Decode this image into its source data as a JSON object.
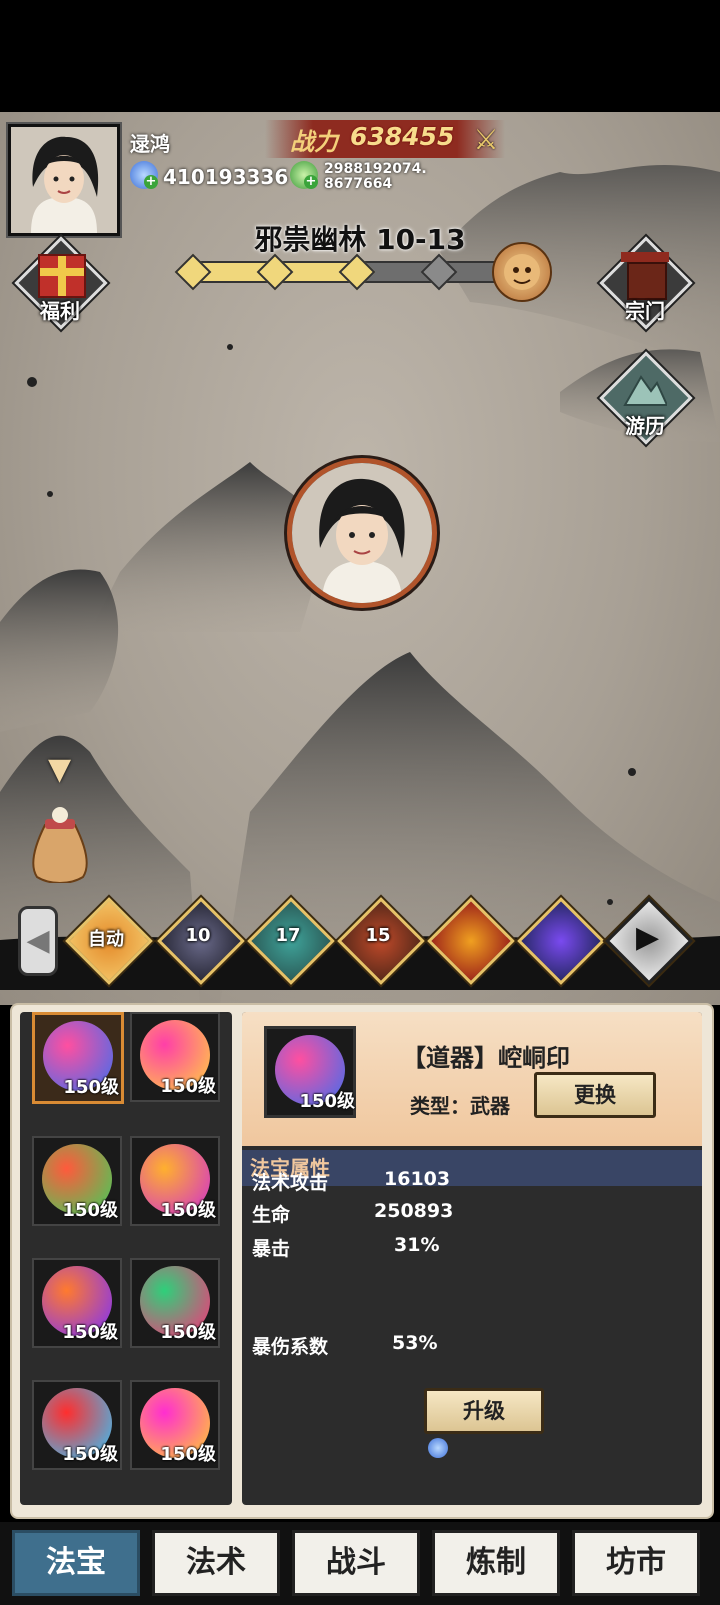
{
  "player": {
    "name": "逯鸿",
    "spirit_stones": "410193336",
    "jade": "2988192074.\n8677664",
    "power_label": "战力",
    "power_value": "638455"
  },
  "stage": {
    "title": "邪祟幽林 10-13",
    "progress_nodes_cleared": 3,
    "progress_nodes_total": 4
  },
  "side_buttons": {
    "welfare": "福利",
    "sect": "宗门",
    "travel": "游历"
  },
  "skills": [
    {
      "label": "自动",
      "icon": "auto-icon"
    },
    {
      "label": "10",
      "icon": "vortex-icon"
    },
    {
      "label": "17",
      "icon": "wind-icon"
    },
    {
      "label": "15",
      "icon": "flame-icon"
    },
    {
      "label": "",
      "icon": "fire-ring-icon"
    },
    {
      "label": "",
      "icon": "palm-icon"
    },
    {
      "label": "",
      "icon": "video-play-icon"
    }
  ],
  "treasures": [
    {
      "level": "150级",
      "icon": "seal-icon",
      "colors": [
        "#ff4fa0",
        "#3b6ef0"
      ]
    },
    {
      "level": "150级",
      "icon": "dagger-icon",
      "colors": [
        "#ff3fa8",
        "#ffd23f"
      ]
    },
    {
      "level": "150级",
      "icon": "armor-icon",
      "colors": [
        "#ff5a3c",
        "#3cd25a"
      ]
    },
    {
      "level": "150级",
      "icon": "boots-icon",
      "colors": [
        "#ffb02e",
        "#d02ed0"
      ]
    },
    {
      "level": "150级",
      "icon": "bracelet-icon",
      "colors": [
        "#ff7a2e",
        "#7a2eff"
      ]
    },
    {
      "level": "150级",
      "icon": "amulet-icon",
      "colors": [
        "#2ed07a",
        "#ff2e7a"
      ]
    },
    {
      "level": "150级",
      "icon": "ring-icon",
      "colors": [
        "#ff2e2e",
        "#2ec8ff"
      ]
    },
    {
      "level": "150级",
      "icon": "beads-icon",
      "colors": [
        "#ff2ed0",
        "#ffd02e"
      ]
    }
  ],
  "detail": {
    "level": "150级",
    "name": "【道器】崆峒印",
    "type": "类型：武器",
    "replace_label": "更换",
    "attr_header": "法宝属性",
    "stats": [
      {
        "name": "法术攻击",
        "value": "16103"
      },
      {
        "name": "生命",
        "value": "250893"
      },
      {
        "name": "暴击",
        "value": "31%"
      },
      {
        "name": "暴伤系数",
        "value": "53%"
      }
    ],
    "upgrade_label": "升级"
  },
  "tabs": [
    "法宝",
    "法术",
    "战斗",
    "炼制",
    "坊市"
  ],
  "active_tab": 0,
  "colors": {
    "accent_orange": "#d98b34",
    "active_tab": "#3f6f8d",
    "attr_header_bg": "#394565"
  }
}
